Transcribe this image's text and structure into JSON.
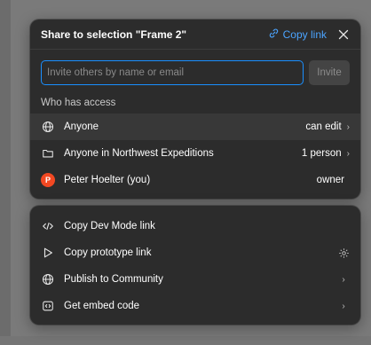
{
  "share": {
    "title": "Share to selection \"Frame 2\"",
    "copy_link_label": "Copy link",
    "invite_placeholder": "Invite others by name or email",
    "invite_value": "",
    "invite_button": "Invite",
    "access_heading": "Who has access",
    "rows": [
      {
        "icon": "globe-icon",
        "label": "Anyone",
        "value": "can edit",
        "has_chevron": true
      },
      {
        "icon": "folder-icon",
        "label": "Anyone in Northwest Expeditions",
        "value": "1 person",
        "has_chevron": true
      },
      {
        "icon": "avatar",
        "avatar_letter": "P",
        "label": "Peter Hoelter (you)",
        "value": "owner",
        "has_chevron": false
      }
    ]
  },
  "actions": {
    "items": [
      {
        "icon": "code-icon",
        "label": "Copy Dev Mode link",
        "right": ""
      },
      {
        "icon": "play-icon",
        "label": "Copy prototype link",
        "right": "settings-icon"
      },
      {
        "icon": "globe-icon",
        "label": "Publish to Community",
        "right": "chevron"
      },
      {
        "icon": "embed-icon",
        "label": "Get embed code",
        "right": "chevron"
      }
    ]
  },
  "colors": {
    "accent": "#1a8fff",
    "link": "#4ba4ff",
    "panel": "#2c2c2c",
    "avatar": "#f24822",
    "backdrop": "#7a7a7a"
  }
}
